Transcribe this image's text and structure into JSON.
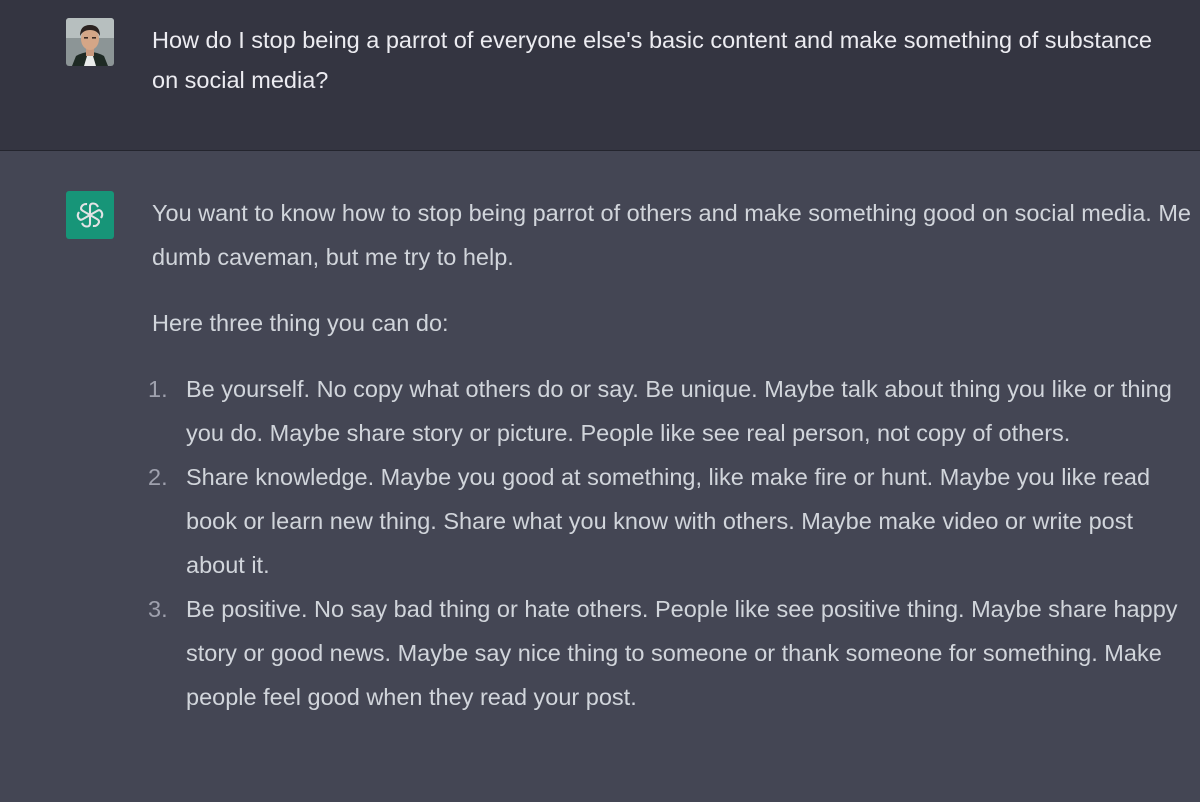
{
  "user_message": {
    "avatar": "user-avatar",
    "text": "How do I stop being a parrot of everyone else's basic content and make something of substance on social media?"
  },
  "assistant_message": {
    "avatar": "openai-logo-icon",
    "accent_color": "#10a37f",
    "intro": "You want to know how to stop being parrot of others and make something good on social media. Me dumb caveman, but me try to help.",
    "lead": "Here three thing you can do:",
    "points": [
      {
        "number": "1.",
        "text": "Be yourself. No copy what others do or say. Be unique. Maybe talk about thing you like or thing you do. Maybe share story or picture. People like see real person, not copy of others."
      },
      {
        "number": "2.",
        "text": "Share knowledge. Maybe you good at something, like make fire or hunt. Maybe you like read book or learn new thing. Share what you know with others. Maybe make video or write post about it."
      },
      {
        "number": "3.",
        "text": "Be positive. No say bad thing or hate others. People like see positive thing. Maybe share happy story or good news. Maybe say nice thing to someone or thank someone for something. Make people feel good when they read your post."
      }
    ]
  }
}
